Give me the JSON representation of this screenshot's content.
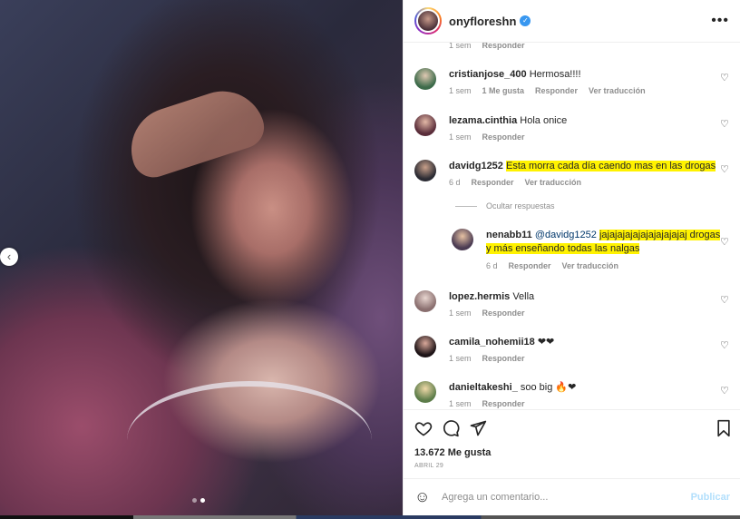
{
  "post": {
    "username": "onyfloreshn",
    "likes": "13.672 Me gusta",
    "date": "ABRIL 29",
    "carousel_total": 2,
    "carousel_active": 2
  },
  "comments": [
    {
      "id": "c0",
      "username": "",
      "text": "",
      "time": "1 sem",
      "likes": "",
      "reply": "Responder",
      "translate": ""
    },
    {
      "id": "c1",
      "username": "cristianjose_400",
      "text": "Hermosa!!!!",
      "time": "1 sem",
      "likes": "1 Me gusta",
      "reply": "Responder",
      "translate": "Ver traducción"
    },
    {
      "id": "c2",
      "username": "lezama.cinthia",
      "text": "Hola onice",
      "time": "1 sem",
      "likes": "",
      "reply": "Responder",
      "translate": ""
    },
    {
      "id": "c3",
      "username": "davidg1252",
      "text": "Esta morra cada día caendo mas en las drogas",
      "time": "6 d",
      "likes": "",
      "reply": "Responder",
      "translate": "Ver traducción",
      "hide_replies": "Ocultar respuestas"
    },
    {
      "id": "r1",
      "username": "nenabb11",
      "mention": "@davidg1252",
      "text_line1": "jajajajajajajajajajajaj drogas",
      "text_line2": "y más enseñando todas las nalgas",
      "time": "6 d",
      "likes": "",
      "reply": "Responder",
      "translate": "Ver traducción"
    },
    {
      "id": "c4",
      "username": "lopez.hermis",
      "text": "Vella",
      "time": "1 sem",
      "likes": "",
      "reply": "Responder",
      "translate": ""
    },
    {
      "id": "c5",
      "username": "camila_nohemii18",
      "text": "❤❤",
      "time": "1 sem",
      "likes": "",
      "reply": "Responder",
      "translate": ""
    },
    {
      "id": "c6",
      "username": "danieltakeshi_",
      "text": "soo big 🔥❤",
      "time": "1 sem",
      "likes": "",
      "reply": "Responder",
      "translate": ""
    }
  ],
  "add_comment": {
    "placeholder": "Agrega un comentario...",
    "publish": "Publicar"
  },
  "icons": {
    "heart": "heart-icon",
    "comment": "comment-icon",
    "share": "share-icon",
    "save": "bookmark-icon",
    "emoji": "emoji-icon",
    "more": "more-icon",
    "prev": "chevron-left-icon"
  },
  "colors": {
    "highlight": "#fff200",
    "verified": "#3897f0",
    "publish": "#b2dffc"
  }
}
